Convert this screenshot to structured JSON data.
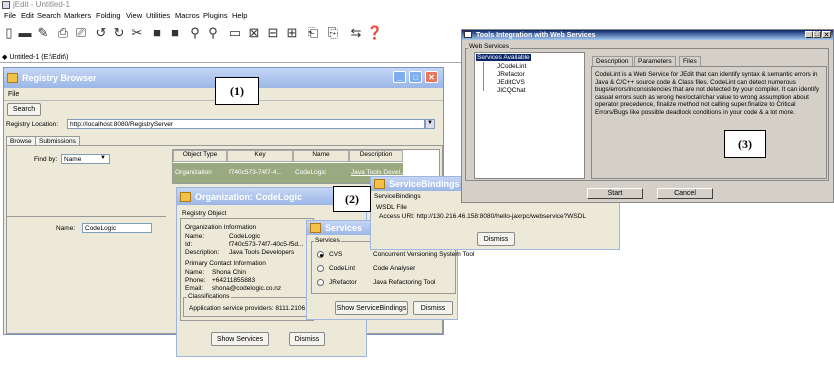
{
  "jedit": {
    "title": "jEdit - Untitled-1",
    "menu": [
      "File",
      "Edit",
      "Search",
      "Markers",
      "Folding",
      "View",
      "Utilities",
      "Macros",
      "Plugins",
      "Help"
    ],
    "buffer_label": "Untitled-1 (E:\\Edit\\)",
    "toolbar_icons": [
      "new-file-icon",
      "open-folder-icon",
      "edit-pencil-icon",
      "print-icon",
      "print-preview-icon",
      "undo-icon",
      "redo-icon",
      "cut-icon",
      "copy-icon",
      "paste-icon",
      "find-icon",
      "find-replace-icon",
      "toggle-icon",
      "split-icon",
      "split-vertical-icon",
      "split-horizontal-icon",
      "buffer-icon",
      "options-icon",
      "plugin-icon",
      "help-icon"
    ]
  },
  "registry": {
    "title": "Registry Browser",
    "menu_file": "File",
    "search_button": "Search",
    "location_label": "Registry Location:",
    "location_value": "http://localhost:8080/RegistryServer",
    "tabs": [
      "Browse",
      "Submissions"
    ],
    "find_by_label": "Find by:",
    "find_by_value": "Name",
    "name_label": "Name:",
    "name_value": "CodeLogic",
    "columns": [
      "Object Type",
      "Key",
      "Name",
      "Description"
    ],
    "row": [
      "Organization",
      "f740c573-74f7-4...",
      "CodeLogic",
      "Java Tools Devel..."
    ]
  },
  "organization": {
    "title": "Organization: CodeLogic",
    "section": "Registry Object",
    "info_header": "Organization Information",
    "fields": [
      {
        "label": "Name:",
        "value": "CodeLogic"
      },
      {
        "label": "Id:",
        "value": "f740c573-74f7-40c5-f5d..."
      },
      {
        "label": "Description:",
        "value": "Java Tools Developers"
      }
    ],
    "contact_header": "Primary Contact Information",
    "contact": [
      {
        "label": "Name:",
        "value": "Shona Chin"
      },
      {
        "label": "Phone:",
        "value": "+64211855883"
      },
      {
        "label": "Email:",
        "value": "shona@codelogic.co.nz"
      }
    ],
    "classifications_label": "Classifications",
    "classifications_value": "Application service providers: 8111.2106",
    "show_services_button": "Show Services",
    "dismiss_button": "Dismiss"
  },
  "services": {
    "title": "Services",
    "group_label": "Services",
    "items": [
      {
        "name": "CVS",
        "desc": "Concurrent Versioning System Tool",
        "selected": true
      },
      {
        "name": "CodeLint",
        "desc": "Code Analyser",
        "selected": false
      },
      {
        "name": "JRefactor",
        "desc": "Java Refactoring Tool",
        "selected": false
      }
    ],
    "show_bindings_button": "Show ServiceBindings",
    "dismiss_button": "Dismiss"
  },
  "bindings": {
    "title": "ServiceBindings",
    "section": "ServiceBindings",
    "wsdl_label": "WSDL File",
    "access_uri": "Access URI: http://130.216.46.158:8080/hello-jaxrpc/webservice?WSDL",
    "dismiss_button": "Dismiss"
  },
  "tools": {
    "title": "Tools Integration with Web Services",
    "group_label": "Web Services",
    "tree_root": "Services Available",
    "tree_items": [
      "JCodeLint",
      "JRefactor",
      "JEditCVS",
      "JICQChat"
    ],
    "tabs": [
      "Description",
      "Parameters",
      "Files"
    ],
    "description": "CodeLint is a Web Service for JEdit that can identify syntax & semantic errors in Java & C/C++ source code & Class files. CodeLint can detect numerous bugs/errors/inconsistencies that are not detected by your compiler. It can identify casual errors such as wrong hex/octal/char value to wrong assumption about operator precedence, finalize method not calling super.finalize to Critical Errors/Bugs like possible deadlock conditions in your code & a lot more.",
    "start_button": "Start",
    "cancel_button": "Cancel"
  },
  "callouts": [
    "(1)",
    "(2)",
    "(3)"
  ]
}
